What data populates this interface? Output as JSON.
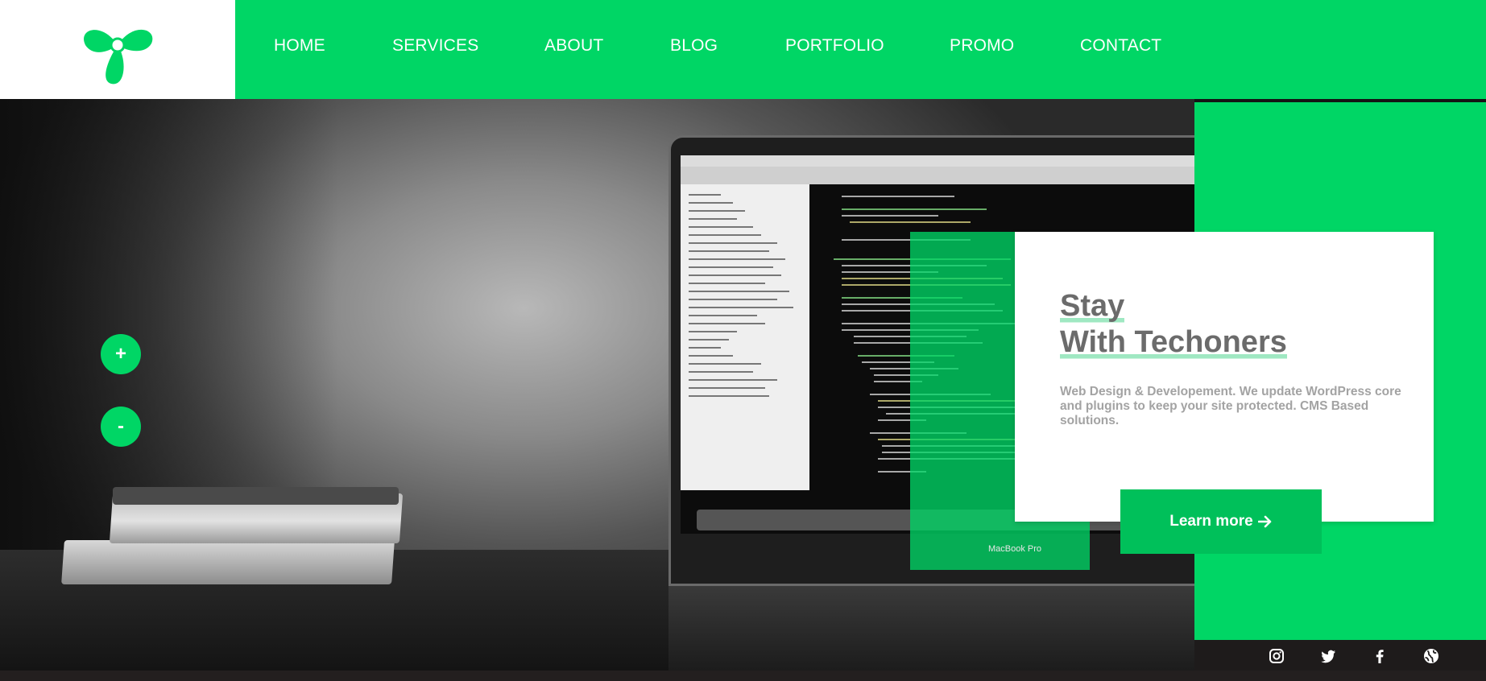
{
  "brand": {
    "logo_icon": "tri-leaf-logo-icon",
    "accent_color": "#00d665"
  },
  "nav": {
    "items": [
      {
        "label": "HOME"
      },
      {
        "label": "SERVICES"
      },
      {
        "label": "ABOUT"
      },
      {
        "label": "BLOG"
      },
      {
        "label": "PORTFOLIO"
      },
      {
        "label": "PROMO"
      },
      {
        "label": "CONTACT"
      }
    ]
  },
  "hero": {
    "zoom_in_label": "+",
    "zoom_out_label": "-",
    "laptop_label": "MacBook Pro"
  },
  "card": {
    "title_line1": "Stay",
    "title_line2": "With Techoners",
    "text": "Web Design & Developement. We update WordPress core and plugins to keep your site protected. CMS Based solutions.",
    "button_label": "Learn more"
  },
  "social": {
    "icons": [
      "instagram-icon",
      "twitter-icon",
      "facebook-icon",
      "globe-icon"
    ]
  }
}
